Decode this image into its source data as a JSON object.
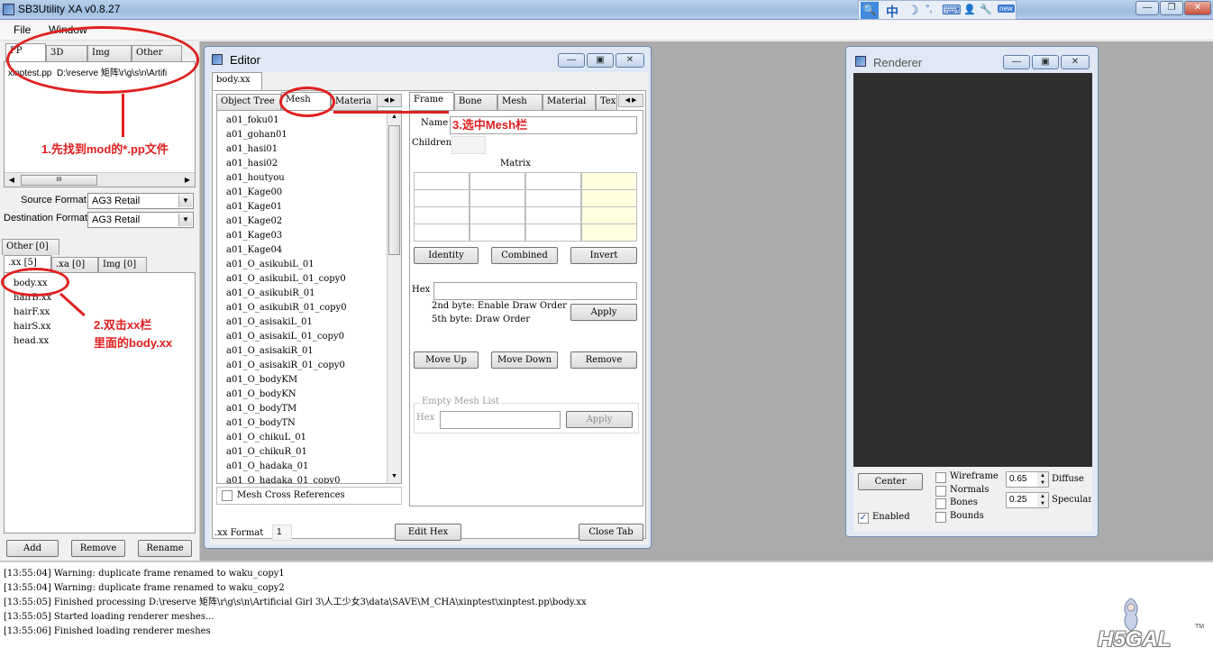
{
  "app": {
    "title": "SB3Utility XA v0.8.27"
  },
  "menu": [
    "File",
    "Window"
  ],
  "ime": {
    "search": "🔍",
    "chinese": "中",
    "moon": "☽",
    "dot": "°,",
    "keyboard": "⌨",
    "user": "👤",
    "wrench": "🔧",
    "badge": "new"
  },
  "left": {
    "top_tabs": [
      "PP",
      "3D",
      "Img",
      "Other"
    ],
    "file_row": {
      "name": "xinptest.pp",
      "path": "D:\\reserve 矩阵\\r\\g\\s\\n\\Artifi"
    },
    "scroll_grip": "III",
    "source_format_label": "Source Format",
    "source_format_value": "AG3 Retail",
    "dest_format_label": "Destination Format",
    "dest_format_value": "AG3 Retail",
    "sub_tab_other": "Other [0]",
    "sub_tabs": [
      ".xx [5]",
      ".xa [0]",
      "Img [0]"
    ],
    "files": [
      "body.xx",
      "hairB.xx",
      "hairF.xx",
      "hairS.xx",
      "head.xx"
    ],
    "buttons": {
      "add": "Add",
      "remove": "Remove",
      "rename": "Rename"
    }
  },
  "annotations": {
    "a1": "1.先找到mod的*.pp文件",
    "a2_line1": "2.双击xx栏",
    "a2_line2": "里面的body.xx",
    "a3": "3.选中Mesh栏"
  },
  "editor": {
    "title": "Editor",
    "doc_tab": "body.xx",
    "left_tabs": [
      "Object Tree",
      "Mesh",
      "Materia"
    ],
    "meshes": [
      "a01_foku01",
      "a01_gohan01",
      "a01_hasi01",
      "a01_hasi02",
      "a01_houtyou",
      "a01_Kage00",
      "a01_Kage01",
      "a01_Kage02",
      "a01_Kage03",
      "a01_Kage04",
      "a01_O_asikubiL_01",
      "a01_O_asikubiL_01_copy0",
      "a01_O_asikubiR_01",
      "a01_O_asikubiR_01_copy0",
      "a01_O_asisakiL_01",
      "a01_O_asisakiL_01_copy0",
      "a01_O_asisakiR_01",
      "a01_O_asisakiR_01_copy0",
      "a01_O_bodyKM",
      "a01_O_bodyKN",
      "a01_O_bodyTM",
      "a01_O_bodyTN",
      "a01_O_chikuL_01",
      "a01_O_chikuR_01",
      "a01_O_hadaka_01",
      "a01_O_hadaka_01_copy0"
    ],
    "mesh_cross_refs": "Mesh Cross References",
    "right_tabs": [
      "Frame",
      "Bone",
      "Mesh",
      "Material",
      "Tex"
    ],
    "name_label": "Name",
    "children_label": "Children",
    "matrix_label": "Matrix",
    "btn_identity": "Identity",
    "btn_combined": "Combined",
    "btn_invert": "Invert",
    "hex_label": "Hex",
    "hex_note1": "2nd byte: Enable Draw Order",
    "hex_note2": "5th byte: Draw Order",
    "btn_apply": "Apply",
    "btn_move_up": "Move Up",
    "btn_move_down": "Move Down",
    "btn_remove": "Remove",
    "empty_mesh_list": "Empty Mesh List",
    "hex2_label": "Hex",
    "btn_apply2": "Apply",
    "format_label": ".xx Format",
    "format_value": "1",
    "btn_edit_hex": "Edit Hex",
    "btn_close_tab": "Close Tab"
  },
  "renderer": {
    "title": "Renderer",
    "btn_center": "Center",
    "enabled": "Enabled",
    "wireframe": "Wireframe",
    "normals": "Normals",
    "bones": "Bones",
    "bounds": "Bounds",
    "diffuse_value": "0.65",
    "diffuse_label": "Diffuse",
    "specular_value": "0.25",
    "specular_label": "Specular",
    "enabled_checked": true
  },
  "log": [
    "[13:55:04] Warning: duplicate frame renamed to waku_copy1",
    "[13:55:04] Warning: duplicate frame renamed to waku_copy2",
    "[13:55:05] Finished processing D:\\reserve 矩阵\\r\\g\\s\\n\\Artificial Girl 3\\人工少女3\\data\\SAVE\\M_CHA\\xinptest\\xinptest.pp\\body.xx",
    "[13:55:05] Started loading renderer meshes...",
    "[13:55:06] Finished loading renderer meshes"
  ],
  "watermark": "H5GAL",
  "watermark_tm": "TM",
  "colors": {
    "annotation": "#e02020",
    "renderer_bg": "#2e2e2e",
    "titlebar": "#b9d1ea"
  }
}
